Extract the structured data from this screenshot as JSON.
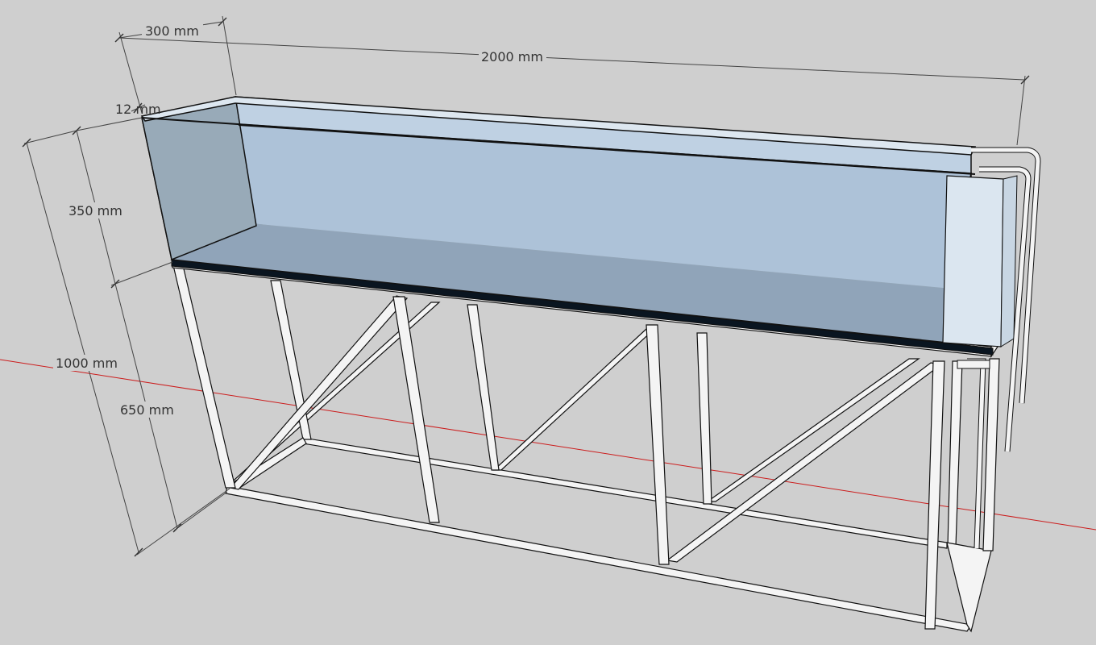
{
  "dimensions": {
    "depth": "300 mm",
    "length": "2000 mm",
    "glass": "12 mm",
    "tank_height": "350 mm",
    "total_height": "1000 mm",
    "stand_height": "650 mm"
  },
  "colors": {
    "background": "#cfcfcf",
    "water": "#b1c7dc",
    "glass_end": "#98aab8",
    "floor": "#060d16",
    "frame": "#f4f4f4",
    "axis": "#cc1c1c"
  }
}
